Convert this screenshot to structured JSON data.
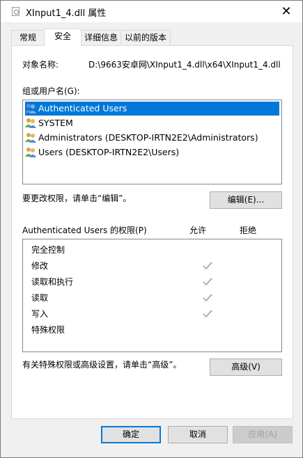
{
  "window": {
    "title": "XInput1_4.dll 属性",
    "close_glyph": "✕"
  },
  "tabs": [
    {
      "label": "常规",
      "active": false
    },
    {
      "label": "安全",
      "active": true
    },
    {
      "label": "详细信息",
      "active": false
    },
    {
      "label": "以前的版本",
      "active": false
    }
  ],
  "security": {
    "object_name_label": "对象名称:",
    "object_name_value": "D:\\9663安卓网\\XInput1_4.dll\\x64\\XInput1_4.dll",
    "group_label": "组或用户名(G):",
    "users": [
      {
        "name": "Authenticated Users",
        "selected": true
      },
      {
        "name": "SYSTEM",
        "selected": false
      },
      {
        "name": "Administrators (DESKTOP-IRTN2E2\\Administrators)",
        "selected": false
      },
      {
        "name": "Users (DESKTOP-IRTN2E2\\Users)",
        "selected": false
      }
    ],
    "change_perm_text": "要更改权限，请单击“编辑”。",
    "edit_button": "编辑(E)...",
    "perm_header": "Authenticated Users 的权限(P)",
    "allow_header": "允许",
    "deny_header": "拒绝",
    "permissions": [
      {
        "name": "完全控制",
        "allow": false
      },
      {
        "name": "修改",
        "allow": true
      },
      {
        "name": "读取和执行",
        "allow": true
      },
      {
        "name": "读取",
        "allow": true
      },
      {
        "name": "写入",
        "allow": true
      },
      {
        "name": "特殊权限",
        "allow": false
      }
    ],
    "advanced_text": "有关特殊权限或高级设置，请单击“高级”。",
    "advanced_button": "高级(V)"
  },
  "footer": {
    "ok": "确定",
    "cancel": "取消",
    "apply": "应用(A)"
  },
  "colors": {
    "selection": "#0078d7",
    "checkmark": "#a8a8a8"
  }
}
